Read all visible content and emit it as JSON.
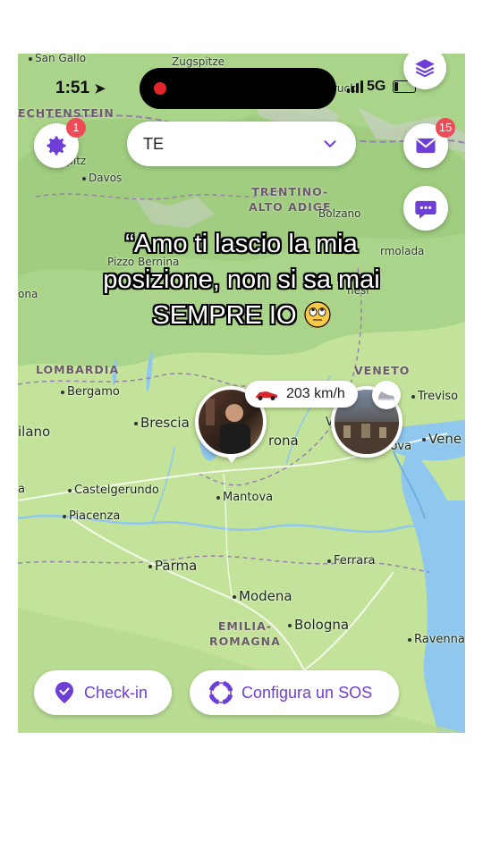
{
  "status_bar": {
    "time": "1:51",
    "network": "5G"
  },
  "top": {
    "settings_badge": "1",
    "messages_badge": "15",
    "selector_value": "TE"
  },
  "caption": {
    "line1": "“Amo ti lascio la mia",
    "line2": "posizione, non si sa mai",
    "line3": "SEMPRE IO"
  },
  "map": {
    "places": {
      "san_gallo": "San Gallo",
      "zugspitze": "Zugspitze",
      "liechtenstein": "ECHTENSTEIN",
      "davos": "Davos",
      "spitz": "spitz",
      "bruck": "ruck",
      "trentino": "TRENTINO-",
      "alto_adige": "ALTO ADIGE",
      "bolzano": "Bolzano",
      "marmolada": "rmolada",
      "pizzo_bernina": "Pizzo Bernina",
      "dolomiti": "Dolomiti",
      "bellunesi": "nesi",
      "ona": "ona",
      "lombardia": "LOMBARDIA",
      "veneto": "VENETO",
      "bergamo": "Bergamo",
      "treviso": "Treviso",
      "brescia": "Brescia",
      "milano": "ilano",
      "verona": "rona",
      "vicenza": "V",
      "padova": "Padova",
      "venezia": "Vene",
      "a": "a",
      "castelgerundo": "Castelgerundo",
      "mantova": "Mantova",
      "piacenza": "Piacenza",
      "parma": "Parma",
      "ferrara": "Ferrara",
      "modena": "Modena",
      "emilia": "EMILIA-",
      "romagna": "ROMAGNA",
      "bologna": "Bologna",
      "ravenna": "Ravenna"
    },
    "speed": "203 km/h"
  },
  "bottom": {
    "checkin_label": "Check-in",
    "sos_label": "Configura un SOS"
  },
  "colors": {
    "accent": "#6e3fd6",
    "badge": "#ee4b56",
    "map_land": "#c9e6a0",
    "sea": "#8fc7ee"
  }
}
